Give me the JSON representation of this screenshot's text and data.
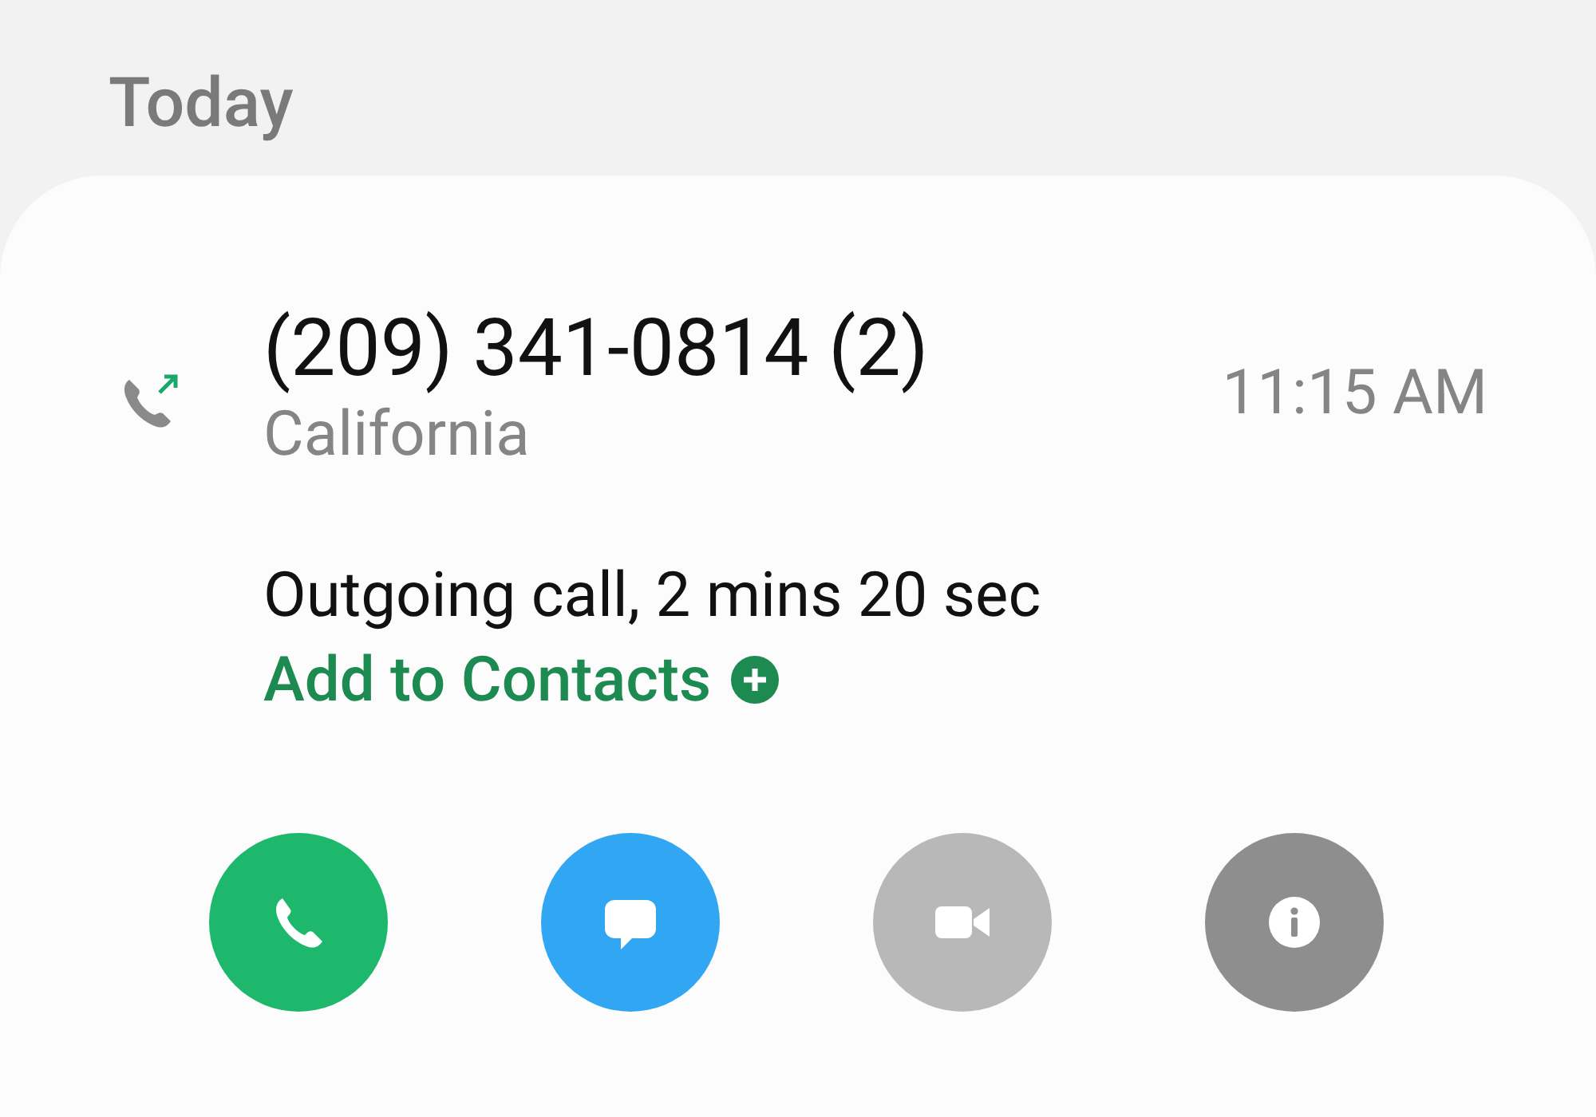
{
  "section": {
    "title": "Today"
  },
  "entry": {
    "number": "(209) 341-0814 (2)",
    "location": "California",
    "time": "11:15 AM",
    "detail": "Outgoing call, 2 mins 20 sec",
    "add_link": "Add to Contacts"
  },
  "actions": [
    {
      "kind": "call",
      "color": "#1db86c"
    },
    {
      "kind": "message",
      "color": "#31a6f2"
    },
    {
      "kind": "video",
      "color": "#b8b8b8"
    },
    {
      "kind": "info",
      "color": "#8e8e8e"
    }
  ]
}
